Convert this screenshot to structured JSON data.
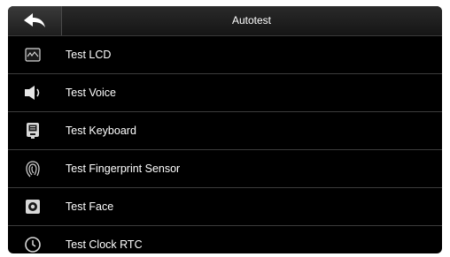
{
  "header": {
    "title": "Autotest",
    "back_icon": "back-arrow-icon"
  },
  "colors": {
    "background": "#000000",
    "text": "#ffffff",
    "divider": "#3c3c3c"
  },
  "items": [
    {
      "label": "Test LCD",
      "icon": "lcd-icon"
    },
    {
      "label": "Test Voice",
      "icon": "speaker-icon"
    },
    {
      "label": "Test Keyboard",
      "icon": "keyboard-icon"
    },
    {
      "label": "Test Fingerprint Sensor",
      "icon": "fingerprint-icon"
    },
    {
      "label": "Test Face",
      "icon": "face-camera-icon"
    },
    {
      "label": "Test Clock RTC",
      "icon": "clock-icon"
    }
  ]
}
